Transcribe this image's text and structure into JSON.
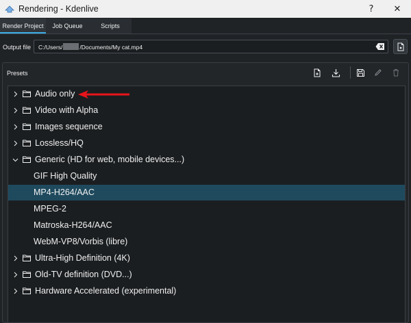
{
  "window": {
    "title": "Rendering - Kdenlive",
    "help_glyph": "?",
    "close_glyph": "✕"
  },
  "tabs": [
    {
      "label": "Render Project",
      "active": true
    },
    {
      "label": "Job Queue",
      "active": false
    },
    {
      "label": "Scripts",
      "active": false
    }
  ],
  "output": {
    "label": "Output file",
    "path_prefix": "C:/Users/",
    "path_suffix": "/Documents/My cat.mp4"
  },
  "presets": {
    "title": "Presets",
    "tools": [
      "new-preset-icon",
      "download-icon",
      "save-preset-icon",
      "edit-icon",
      "delete-icon"
    ],
    "items": [
      {
        "label": "Audio only",
        "type": "group",
        "expanded": false
      },
      {
        "label": "Video with Alpha",
        "type": "group",
        "expanded": false
      },
      {
        "label": "Images sequence",
        "type": "group",
        "expanded": false
      },
      {
        "label": "Lossless/HQ",
        "type": "group",
        "expanded": false
      },
      {
        "label": "Generic (HD for web, mobile devices...)",
        "type": "group",
        "expanded": true
      },
      {
        "label": "GIF High Quality",
        "type": "preset",
        "selected": false
      },
      {
        "label": "MP4-H264/AAC",
        "type": "preset",
        "selected": true
      },
      {
        "label": "MPEG-2",
        "type": "preset",
        "selected": false
      },
      {
        "label": "Matroska-H264/AAC",
        "type": "preset",
        "selected": false
      },
      {
        "label": "WebM-VP8/Vorbis (libre)",
        "type": "preset",
        "selected": false
      },
      {
        "label": "Ultra-High Definition (4K)",
        "type": "group",
        "expanded": false
      },
      {
        "label": "Old-TV definition (DVD...)",
        "type": "group",
        "expanded": false
      },
      {
        "label": "Hardware Accelerated (experimental)",
        "type": "group",
        "expanded": false
      }
    ]
  },
  "colors": {
    "selection": "#1f4a5e",
    "accent": "#3daee9",
    "annotation_arrow": "#e8141b"
  }
}
